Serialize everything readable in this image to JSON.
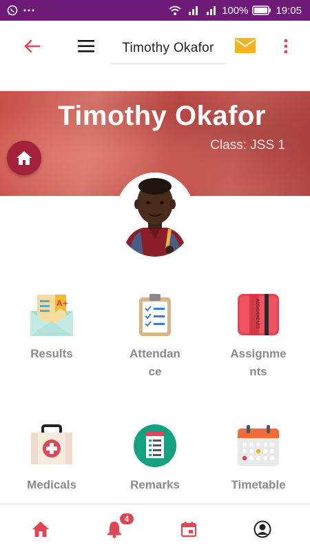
{
  "status_bar": {
    "battery": "100%",
    "time": "19:05",
    "icons": [
      "whatsapp-icon",
      "more-dots-icon",
      "wifi-icon",
      "signal-icon",
      "signal-icon",
      "battery-icon"
    ]
  },
  "app_bar": {
    "title": "Timothy Okafor",
    "icons": {
      "back": "back-arrow-icon",
      "menu": "hamburger-menu-icon",
      "mail": "mail-icon",
      "more": "more-vert-icon"
    }
  },
  "banner": {
    "name": "Timothy Okafor",
    "class_label": "Class: JSS 1"
  },
  "tiles": [
    {
      "label": "Results",
      "icon": "results-icon"
    },
    {
      "label": "Attendance",
      "icon": "attendance-icon"
    },
    {
      "label": "Assignments",
      "icon": "assignments-icon"
    },
    {
      "label": "Medicals",
      "icon": "medicals-icon"
    },
    {
      "label": "Remarks",
      "icon": "remarks-icon"
    },
    {
      "label": "Timetable",
      "icon": "timetable-icon"
    }
  ],
  "bottom_nav": {
    "items": [
      "home-icon",
      "notifications-icon",
      "calendar-icon",
      "profile-icon"
    ],
    "notification_count": "4"
  },
  "colors": {
    "status_bar": "#6e1b78",
    "accent_red": "#e14452",
    "fab": "#a3213a",
    "mail": "#f2b51b",
    "label_gray": "#8a8a8a"
  }
}
